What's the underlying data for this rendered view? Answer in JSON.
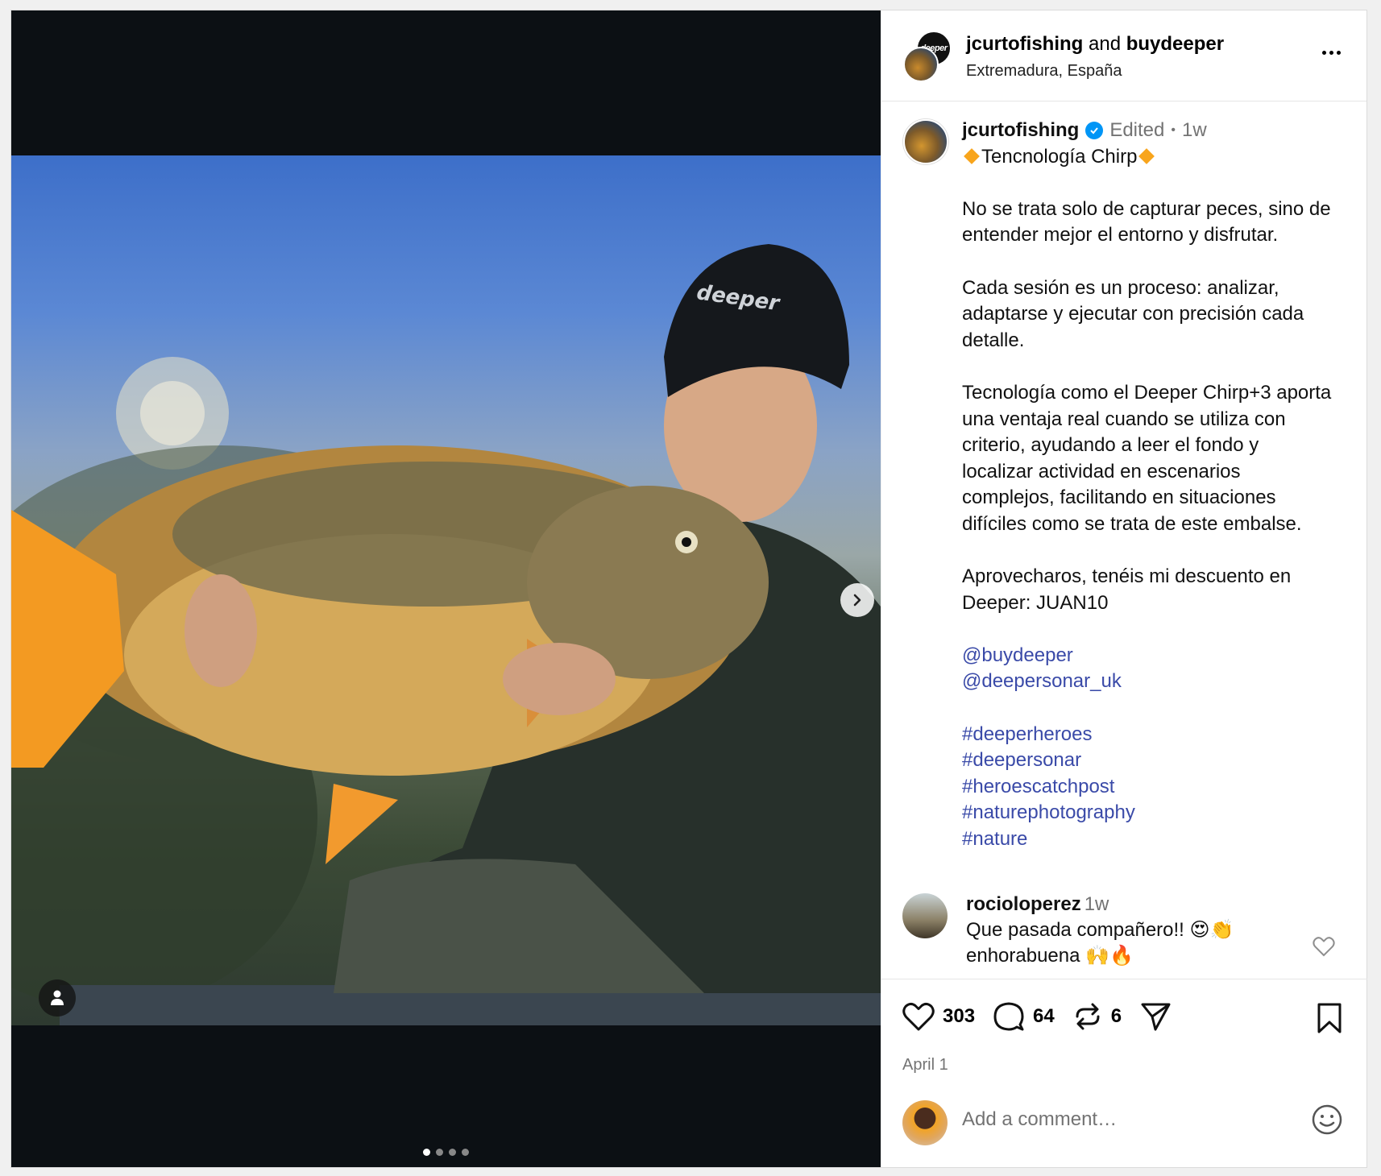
{
  "header": {
    "user_primary": "jcurtofishing",
    "joiner": "and",
    "user_secondary": "buydeeper",
    "location": "Extremadura, España",
    "secondary_avatar_text": "deeper"
  },
  "media": {
    "slides": 4,
    "active_slide": 1,
    "hat_text": "deeper"
  },
  "caption": {
    "username": "jcurtofishing",
    "edited": "Edited",
    "dot": "•",
    "time": "1w",
    "title": "Tencnología Chirp",
    "p1": "No se trata solo de capturar peces, sino de entender mejor el entorno y disfrutar.",
    "p2": "Cada sesión es un proceso: analizar, adaptarse y ejecutar con precisión cada detalle.",
    "p3": "Tecnología como el Deeper Chirp+3 aporta una ventaja real cuando se utiliza con criterio, ayudando a leer el fondo y localizar actividad en escenarios complejos, facilitando en situaciones difíciles como se trata de este embalse.",
    "p4": "Aprovecharos, tenéis mi descuento en Deeper: JUAN10",
    "mentions": [
      "@buydeeper",
      "@deepersonar_uk"
    ],
    "hashtags": [
      "#deeperheroes",
      "#deepersonar",
      "#heroescatchpost",
      "#naturephotography",
      "#nature"
    ]
  },
  "comment": {
    "username": "rocioloperez",
    "time": "1w",
    "line1": "Que pasada compañero!! 😍👏",
    "line2": "enhorabuena 🙌🔥"
  },
  "actions": {
    "likes": "303",
    "comments": "64",
    "reposts": "6",
    "date": "April 1"
  },
  "add_comment": {
    "placeholder": "Add a comment…"
  }
}
